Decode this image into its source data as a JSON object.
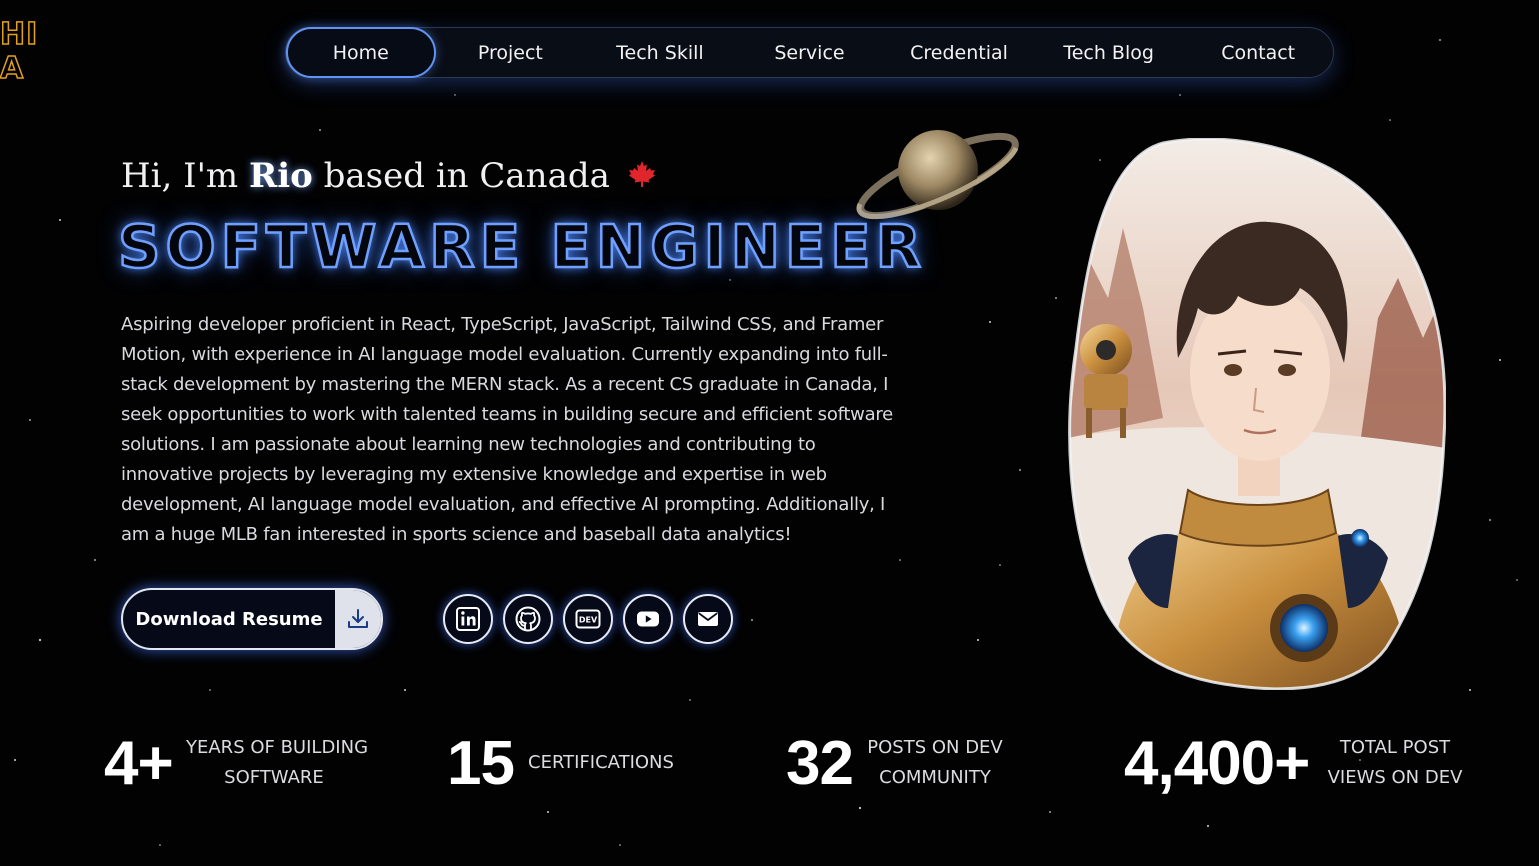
{
  "corner_logo": [
    "HI",
    "A"
  ],
  "nav": {
    "items": [
      {
        "label": "Home",
        "active": true
      },
      {
        "label": "Project"
      },
      {
        "label": "Tech Skill"
      },
      {
        "label": "Service"
      },
      {
        "label": "Credential"
      },
      {
        "label": "Tech Blog"
      },
      {
        "label": "Contact"
      }
    ]
  },
  "hero": {
    "greeting_prefix": "Hi, I'm ",
    "name": "Rio",
    "greeting_suffix": " based in Canada",
    "title": "SOFTWARE ENGINEER",
    "bio": "Aspiring developer proficient in React, TypeScript, JavaScript, Tailwind CSS, and Framer Motion, with experience in AI language model evaluation. Currently expanding into full-stack development by mastering the MERN stack. As a recent CS graduate in Canada, I seek opportunities to work with talented teams in building secure and efficient software solutions. I am passionate about learning new technologies and contributing to innovative projects by leveraging my extensive knowledge and expertise in web development, AI language model evaluation, and effective AI prompting. Additionally, I am a huge MLB fan interested in sports science and baseball data analytics!",
    "resume_label": "Download Resume"
  },
  "socials": [
    "linkedin-icon",
    "github-icon",
    "dev-icon",
    "youtube-icon",
    "mail-icon"
  ],
  "dev_icon_text": "DEV",
  "stats": [
    {
      "value": "4+",
      "label_line1": "YEARS OF BUILDING",
      "label_line2": "SOFTWARE"
    },
    {
      "value": "15",
      "label_line1": "CERTIFICATIONS",
      "label_line2": ""
    },
    {
      "value": "32",
      "label_line1": "POSTS ON DEV",
      "label_line2": "COMMUNITY"
    },
    {
      "value": "4,400+",
      "label_line1": "TOTAL POST",
      "label_line2": "VIEWS ON DEV"
    }
  ],
  "colors": {
    "accent": "#5f94f2",
    "title_glow": "#6fa0ff",
    "logo": "#e3a11b",
    "maple": "#e0262c"
  }
}
